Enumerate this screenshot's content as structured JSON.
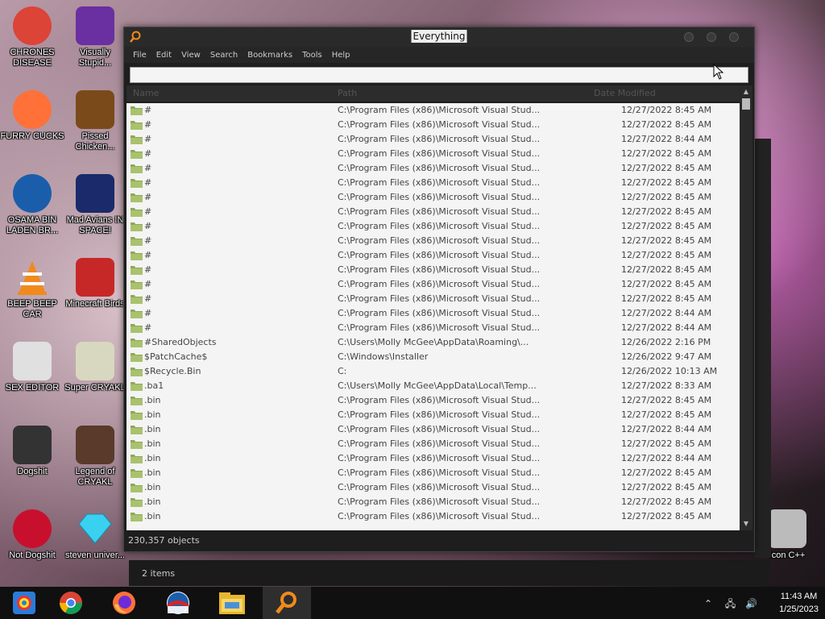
{
  "desktop": {
    "icons": [
      {
        "label": "CHRONES DISEASE",
        "icon": "chrome-icon"
      },
      {
        "label": "Visually Stupid...",
        "icon": "visual-studio-icon"
      },
      {
        "label": "FURRY CUCKS",
        "icon": "firefox-icon"
      },
      {
        "label": "Pissed Chicken...",
        "icon": "angry-birds-seasons-icon"
      },
      {
        "label": "OSAMA BIN LADEN BR...",
        "icon": "obama-logo-icon"
      },
      {
        "label": "Mad Avians IN SPACE!",
        "icon": "angry-birds-space-icon"
      },
      {
        "label": "BEEP BEEP CAR",
        "icon": "vlc-icon"
      },
      {
        "label": "Minecraft Birds",
        "icon": "angry-birds-icon"
      },
      {
        "label": "SEX EDITOR",
        "icon": "hxd-icon"
      },
      {
        "label": "Super CRYAKL",
        "icon": "pixel-character-icon"
      },
      {
        "label": "Dogshit",
        "icon": "codeblocks-icon"
      },
      {
        "label": "Legend of CRYAKL",
        "icon": "cartoon-character-icon"
      },
      {
        "label": "Not Dogshit",
        "icon": "devcpp-icon"
      },
      {
        "label": "steven univer...",
        "icon": "diamond-icon"
      },
      {
        "label": "Icon C++",
        "icon": "recycle-bin-icon"
      }
    ]
  },
  "window": {
    "title": "Everything",
    "menu": [
      "File",
      "Edit",
      "View",
      "Search",
      "Bookmarks",
      "Tools",
      "Help"
    ],
    "search_value": "",
    "columns": [
      "Name",
      "Path",
      "Date Modified"
    ],
    "rows": [
      {
        "name": "#",
        "path": "C:\\Program Files (x86)\\Microsoft Visual Stud...",
        "date": "12/27/2022 8:45 AM"
      },
      {
        "name": "#",
        "path": "C:\\Program Files (x86)\\Microsoft Visual Stud...",
        "date": "12/27/2022 8:45 AM"
      },
      {
        "name": "#",
        "path": "C:\\Program Files (x86)\\Microsoft Visual Stud...",
        "date": "12/27/2022 8:44 AM"
      },
      {
        "name": "#",
        "path": "C:\\Program Files (x86)\\Microsoft Visual Stud...",
        "date": "12/27/2022 8:45 AM"
      },
      {
        "name": "#",
        "path": "C:\\Program Files (x86)\\Microsoft Visual Stud...",
        "date": "12/27/2022 8:45 AM"
      },
      {
        "name": "#",
        "path": "C:\\Program Files (x86)\\Microsoft Visual Stud...",
        "date": "12/27/2022 8:45 AM"
      },
      {
        "name": "#",
        "path": "C:\\Program Files (x86)\\Microsoft Visual Stud...",
        "date": "12/27/2022 8:45 AM"
      },
      {
        "name": "#",
        "path": "C:\\Program Files (x86)\\Microsoft Visual Stud...",
        "date": "12/27/2022 8:45 AM"
      },
      {
        "name": "#",
        "path": "C:\\Program Files (x86)\\Microsoft Visual Stud...",
        "date": "12/27/2022 8:45 AM"
      },
      {
        "name": "#",
        "path": "C:\\Program Files (x86)\\Microsoft Visual Stud...",
        "date": "12/27/2022 8:45 AM"
      },
      {
        "name": "#",
        "path": "C:\\Program Files (x86)\\Microsoft Visual Stud...",
        "date": "12/27/2022 8:45 AM"
      },
      {
        "name": "#",
        "path": "C:\\Program Files (x86)\\Microsoft Visual Stud...",
        "date": "12/27/2022 8:45 AM"
      },
      {
        "name": "#",
        "path": "C:\\Program Files (x86)\\Microsoft Visual Stud...",
        "date": "12/27/2022 8:45 AM"
      },
      {
        "name": "#",
        "path": "C:\\Program Files (x86)\\Microsoft Visual Stud...",
        "date": "12/27/2022 8:45 AM"
      },
      {
        "name": "#",
        "path": "C:\\Program Files (x86)\\Microsoft Visual Stud...",
        "date": "12/27/2022 8:44 AM"
      },
      {
        "name": "#",
        "path": "C:\\Program Files (x86)\\Microsoft Visual Stud...",
        "date": "12/27/2022 8:44 AM"
      },
      {
        "name": "#SharedObjects",
        "path": "C:\\Users\\Molly McGee\\AppData\\Roaming\\...",
        "date": "12/26/2022 2:16 PM"
      },
      {
        "name": "$PatchCache$",
        "path": "C:\\Windows\\Installer",
        "date": "12/26/2022 9:47 AM"
      },
      {
        "name": "$Recycle.Bin",
        "path": "C:",
        "date": "12/26/2022 10:13 AM"
      },
      {
        "name": ".ba1",
        "path": "C:\\Users\\Molly McGee\\AppData\\Local\\Temp...",
        "date": "12/27/2022 8:33 AM"
      },
      {
        "name": ".bin",
        "path": "C:\\Program Files (x86)\\Microsoft Visual Stud...",
        "date": "12/27/2022 8:45 AM"
      },
      {
        "name": ".bin",
        "path": "C:\\Program Files (x86)\\Microsoft Visual Stud...",
        "date": "12/27/2022 8:45 AM"
      },
      {
        "name": ".bin",
        "path": "C:\\Program Files (x86)\\Microsoft Visual Stud...",
        "date": "12/27/2022 8:44 AM"
      },
      {
        "name": ".bin",
        "path": "C:\\Program Files (x86)\\Microsoft Visual Stud...",
        "date": "12/27/2022 8:45 AM"
      },
      {
        "name": ".bin",
        "path": "C:\\Program Files (x86)\\Microsoft Visual Stud...",
        "date": "12/27/2022 8:44 AM"
      },
      {
        "name": ".bin",
        "path": "C:\\Program Files (x86)\\Microsoft Visual Stud...",
        "date": "12/27/2022 8:45 AM"
      },
      {
        "name": ".bin",
        "path": "C:\\Program Files (x86)\\Microsoft Visual Stud...",
        "date": "12/27/2022 8:45 AM"
      },
      {
        "name": ".bin",
        "path": "C:\\Program Files (x86)\\Microsoft Visual Stud...",
        "date": "12/27/2022 8:45 AM"
      },
      {
        "name": ".bin",
        "path": "C:\\Program Files (x86)\\Microsoft Visual Stud...",
        "date": "12/27/2022 8:45 AM"
      }
    ],
    "status": "230,357 objects"
  },
  "explorer_fragment": {
    "items_count": "2 items"
  },
  "taskbar": {
    "apps": [
      "windows-icon",
      "chrome-icon",
      "firefox-icon",
      "obama-logo-icon",
      "file-explorer-icon",
      "everything-search-icon"
    ],
    "time": "11:43 AM",
    "date": "1/25/2023"
  },
  "colors": {
    "accent_orange": "#f08a1c",
    "window_bg": "#1e1e1e",
    "list_bg": "#f4f4f4"
  }
}
